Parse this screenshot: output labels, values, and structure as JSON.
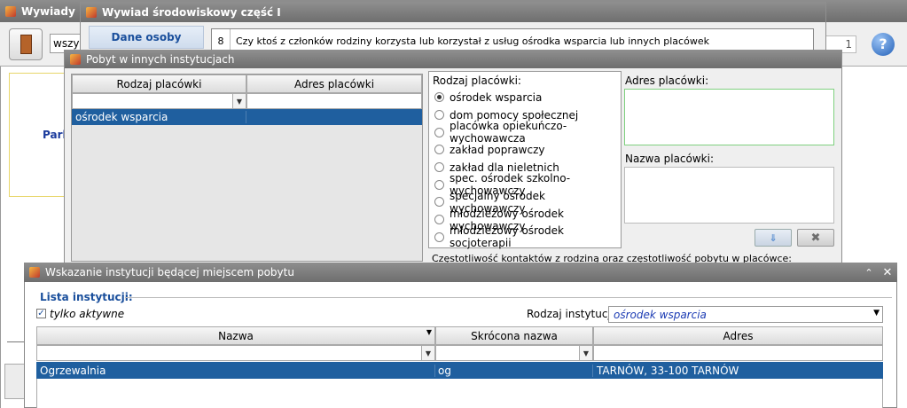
{
  "main_window": {
    "title": "Wywiady",
    "search_value": "wszys",
    "page_label": "1",
    "side_text": "Parl"
  },
  "interview_window": {
    "title": "Wywiad środowiskowy część I",
    "tab_label": "Dane osoby",
    "question_number": "8",
    "question_text": "Czy ktoś z członków rodziny korzysta lub korzystał z usług ośrodka wsparcia lub innych placówek"
  },
  "stay_window": {
    "title": "Pobyt w innych instytucjach",
    "columns": [
      "Rodzaj placówki",
      "Adres placówki"
    ],
    "rows": [
      {
        "type": "ośrodek wsparcia",
        "address": ""
      }
    ],
    "facility_type_label": "Rodzaj placówki:",
    "facility_types": [
      "ośrodek wsparcia",
      "dom pomocy społecznej",
      "placówka opiekuńczo-wychowawcza",
      "zakład poprawczy",
      "zakład dla nieletnich",
      "spec. ośrodek szkolno-wychowawczy",
      "specjalny ośrodek wychowawczy",
      "młodzieżowy ośrodek wychowawczy",
      "młodzieżowy ośrodek socjoterapii"
    ],
    "selected_type_index": 0,
    "address_label": "Adres placówki:",
    "name_label": "Nazwa placówki:",
    "contact_label": "Częstotliwość kontaktów z rodziną oraz częstotliwość pobytu w placówce:"
  },
  "institution_window": {
    "title": "Wskazanie instytucji będącej miejscem pobytu",
    "group_label": "Lista instytucji:",
    "active_only_label": "tylko aktywne",
    "active_only_checked": true,
    "type_label": "Rodzaj instytucji:",
    "type_value": "ośrodek wsparcia",
    "columns": [
      "Nazwa",
      "Skrócona nazwa",
      "Adres"
    ],
    "rows": [
      {
        "name": "Ogrzewalnia",
        "short": "og",
        "address": "TARNÓW, 33-100 TARNÓW"
      }
    ]
  },
  "colors": {
    "selection": "#1f5f9f",
    "link_blue": "#1a4f9c",
    "green_border": "#7fd07f"
  }
}
